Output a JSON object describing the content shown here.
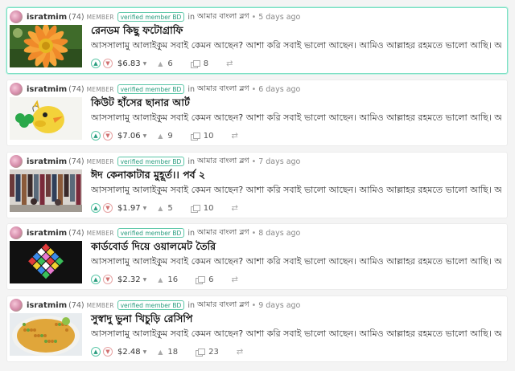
{
  "posts": [
    {
      "author": "isratmim",
      "reputation": "(74)",
      "member_label": "MEMBER",
      "badge": "verified member BD",
      "in_word": "in",
      "community": "আমার বাংলা ব্লগ",
      "time": "5 days ago",
      "title": "রেনডম কিছু ফটোগ্রাফি",
      "body": "আসসালামু আলাইকুম সবাই কেমন আছেন? আশা করি সবাই ভালো আছেন। আমিও আল্লাহর রহমতে ভালো আছি। আজ...",
      "payout": "$6.83",
      "votes": "6",
      "replies": "8",
      "thumb": "flower"
    },
    {
      "author": "isratmim",
      "reputation": "(74)",
      "member_label": "MEMBER",
      "badge": "verified member BD",
      "in_word": "in",
      "community": "আমার বাংলা ব্লগ",
      "time": "6 days ago",
      "title": "কিউট হাঁসের ছানার আর্ট",
      "body": "আসসালামু আলাইকুম সবাই কেমন আছেন? আশা করি সবাই ভালো আছেন। আমিও আল্লাহর রহমতে ভালো আছি। আজ...",
      "payout": "$7.06",
      "votes": "9",
      "replies": "10",
      "thumb": "duckling"
    },
    {
      "author": "isratmim",
      "reputation": "(74)",
      "member_label": "MEMBER",
      "badge": "verified member BD",
      "in_word": "in",
      "community": "আমার বাংলা ব্লগ",
      "time": "7 days ago",
      "title": "ঈদ কেনাকাটার মুহূর্ত।। পর্ব ২",
      "body": "আসসালামু আলাইকুম সবাই কেমন আছেন? আশা করি সবাই ভালো আছেন। আমিও আল্লাহর রহমতে ভালো আছি। আজ...",
      "payout": "$1.97",
      "votes": "5",
      "replies": "10",
      "thumb": "shop"
    },
    {
      "author": "isratmim",
      "reputation": "(74)",
      "member_label": "MEMBER",
      "badge": "verified member BD",
      "in_word": "in",
      "community": "আমার বাংলা ব্লগ",
      "time": "8 days ago",
      "title": "কার্ডবোর্ড দিয়ে ওয়ালমেট তৈরি",
      "body": "আসসালামু আলাইকুম সবাই কেমন আছেন? আশা করি সবাই ভালো আছেন। আমিও আল্লাহর রহমতে ভালো আছি। আজ...",
      "payout": "$2.32",
      "votes": "16",
      "replies": "6",
      "thumb": "wallmat"
    },
    {
      "author": "isratmim",
      "reputation": "(74)",
      "member_label": "MEMBER",
      "badge": "verified member BD",
      "in_word": "in",
      "community": "আমার বাংলা ব্লগ",
      "time": "9 days ago",
      "title": "সুস্বাদু ভুনা খিচুড়ি রেসিপি",
      "body": "আসসালামু আলাইকুম সবাই কেমন আছেন? আশা করি সবাই ভালো আছেন। আমিও আল্লাহর রহমতে ভালো আছি। আজ...",
      "payout": "$2.48",
      "votes": "18",
      "replies": "23",
      "thumb": "khichuri"
    }
  ],
  "icons": {
    "upvote": "chevron-up-icon",
    "downvote": "chevron-down-icon",
    "payout_menu": "caret-down-icon",
    "voters": "voters-icon",
    "replies": "replies-icon",
    "resteem": "resteem-icon"
  },
  "colors": {
    "accent": "#5cc7a8",
    "downvote": "#e6a3a3",
    "active_border": "#7fe0c5"
  }
}
